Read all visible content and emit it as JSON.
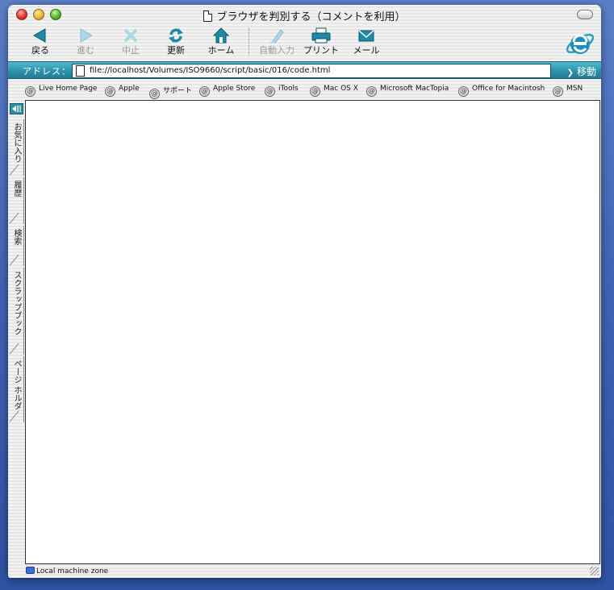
{
  "window": {
    "title": "ブラウザを判別する（コメントを利用）"
  },
  "toolbar": {
    "buttons": [
      {
        "label": "戻る",
        "icon": "back-arrow-icon",
        "enabled": true
      },
      {
        "label": "進む",
        "icon": "forward-arrow-icon",
        "enabled": false
      },
      {
        "label": "中止",
        "icon": "stop-x-icon",
        "enabled": false
      },
      {
        "label": "更新",
        "icon": "refresh-icon",
        "enabled": true
      },
      {
        "label": "ホーム",
        "icon": "home-icon",
        "enabled": true
      },
      {
        "label": "自動入力",
        "icon": "autofill-icon",
        "enabled": false
      },
      {
        "label": "プリント",
        "icon": "printer-icon",
        "enabled": true
      },
      {
        "label": "メール",
        "icon": "mail-icon",
        "enabled": true
      }
    ]
  },
  "address": {
    "label": "アドレス：",
    "url": "file://localhost/Volumes/ISO9660/script/basic/016/code.html",
    "go_label": "移動"
  },
  "favorites": [
    "Live Home Page",
    "Apple",
    "サポート",
    "Apple Store",
    "iTools",
    "Mac OS X",
    "Microsoft MacTopia",
    "Office for Macintosh",
    "MSN"
  ],
  "sidebar": {
    "tabs": [
      "お気に入り",
      "履歴",
      "検索",
      "スクラップブック",
      "ページ ホルダ"
    ]
  },
  "status": {
    "zone": "Local machine zone"
  },
  "colors": {
    "accent": "#2a8fa8",
    "desktop": "#3f63b4"
  }
}
